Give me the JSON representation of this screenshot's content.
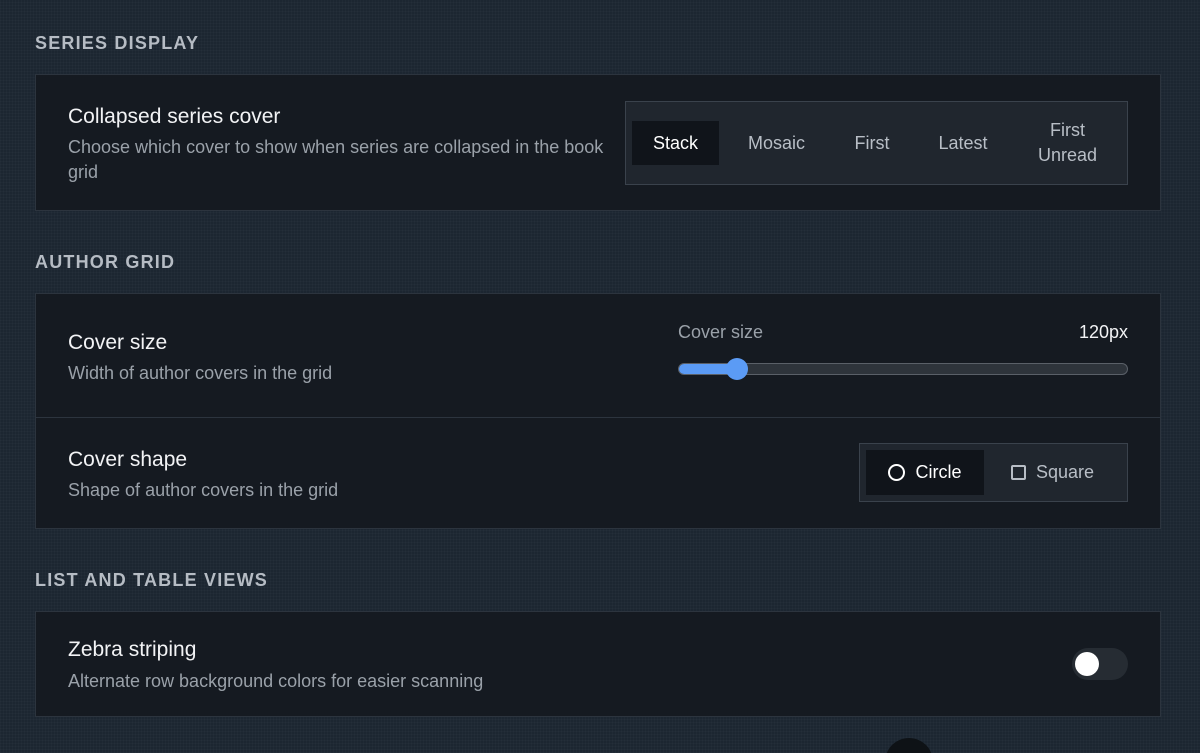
{
  "sections": {
    "series_display": "SERIES DISPLAY",
    "author_grid": "AUTHOR GRID",
    "list_table": "LIST AND TABLE VIEWS"
  },
  "collapsed_cover": {
    "title": "Collapsed series cover",
    "description": "Choose which cover to show when series are collapsed in the book grid",
    "options": [
      "Stack",
      "Mosaic",
      "First",
      "Latest",
      "First Unread"
    ],
    "selected": "Stack"
  },
  "cover_size": {
    "title": "Cover size",
    "description": "Width of author covers in the grid",
    "slider_label": "Cover size",
    "value_text": "120px",
    "fill_fraction": 0.13
  },
  "cover_shape": {
    "title": "Cover shape",
    "description": "Shape of author covers in the grid",
    "options": [
      "Circle",
      "Square"
    ],
    "selected": "Circle",
    "icons": [
      "circle-icon",
      "square-icon"
    ]
  },
  "zebra": {
    "title": "Zebra striping",
    "description": "Alternate row background colors for easier scanning",
    "enabled": false
  },
  "colors": {
    "accent": "#5b9bf5",
    "background": "#1c2631",
    "card": "#151a21"
  }
}
